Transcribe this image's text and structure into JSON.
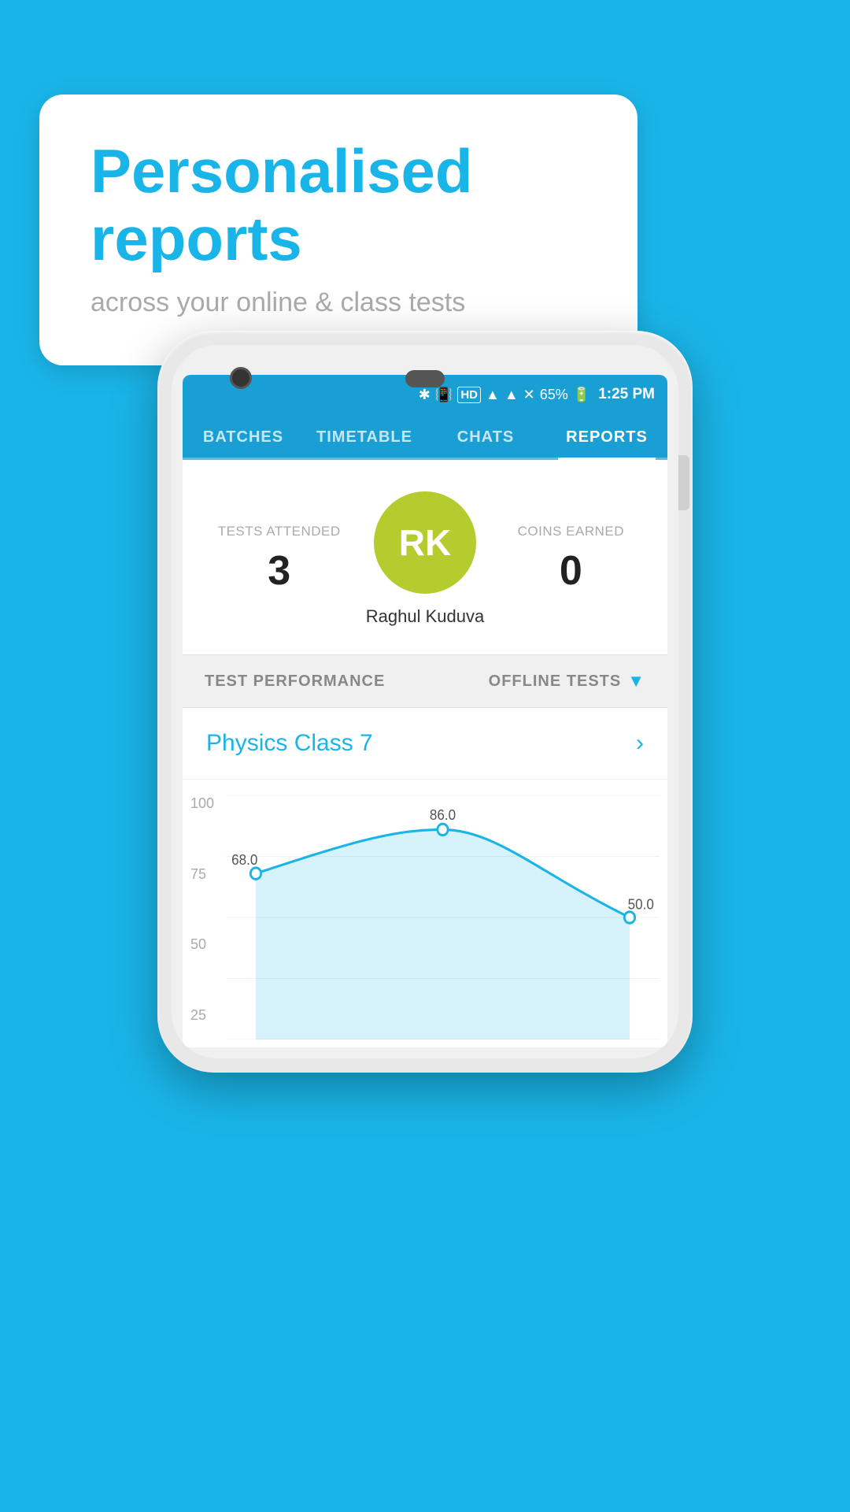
{
  "bubble": {
    "title": "Personalised reports",
    "subtitle": "across your online & class tests"
  },
  "statusBar": {
    "battery": "65%",
    "time": "1:25 PM"
  },
  "navTabs": [
    {
      "id": "batches",
      "label": "BATCHES",
      "active": false
    },
    {
      "id": "timetable",
      "label": "TIMETABLE",
      "active": false
    },
    {
      "id": "chats",
      "label": "CHATS",
      "active": false
    },
    {
      "id": "reports",
      "label": "REPORTS",
      "active": true
    }
  ],
  "profile": {
    "avatar_initials": "RK",
    "name": "Raghul Kuduva",
    "tests_attended_label": "TESTS ATTENDED",
    "tests_attended_value": "3",
    "coins_earned_label": "COINS EARNED",
    "coins_earned_value": "0"
  },
  "sectionBar": {
    "left": "TEST PERFORMANCE",
    "right": "OFFLINE TESTS"
  },
  "classRow": {
    "name": "Physics Class 7",
    "arrow": "›"
  },
  "chart": {
    "y_labels": [
      "100",
      "75",
      "50",
      "25"
    ],
    "data_points": [
      {
        "x": 0,
        "y": 68.0,
        "label": "68.0"
      },
      {
        "x": 1,
        "y": 86.0,
        "label": "86.0"
      },
      {
        "x": 2,
        "y": 50.0,
        "label": "50.0"
      }
    ],
    "colors": {
      "line": "#1ab5e8",
      "fill": "rgba(26,181,232,0.2)",
      "dot": "#1ab5e8"
    }
  }
}
